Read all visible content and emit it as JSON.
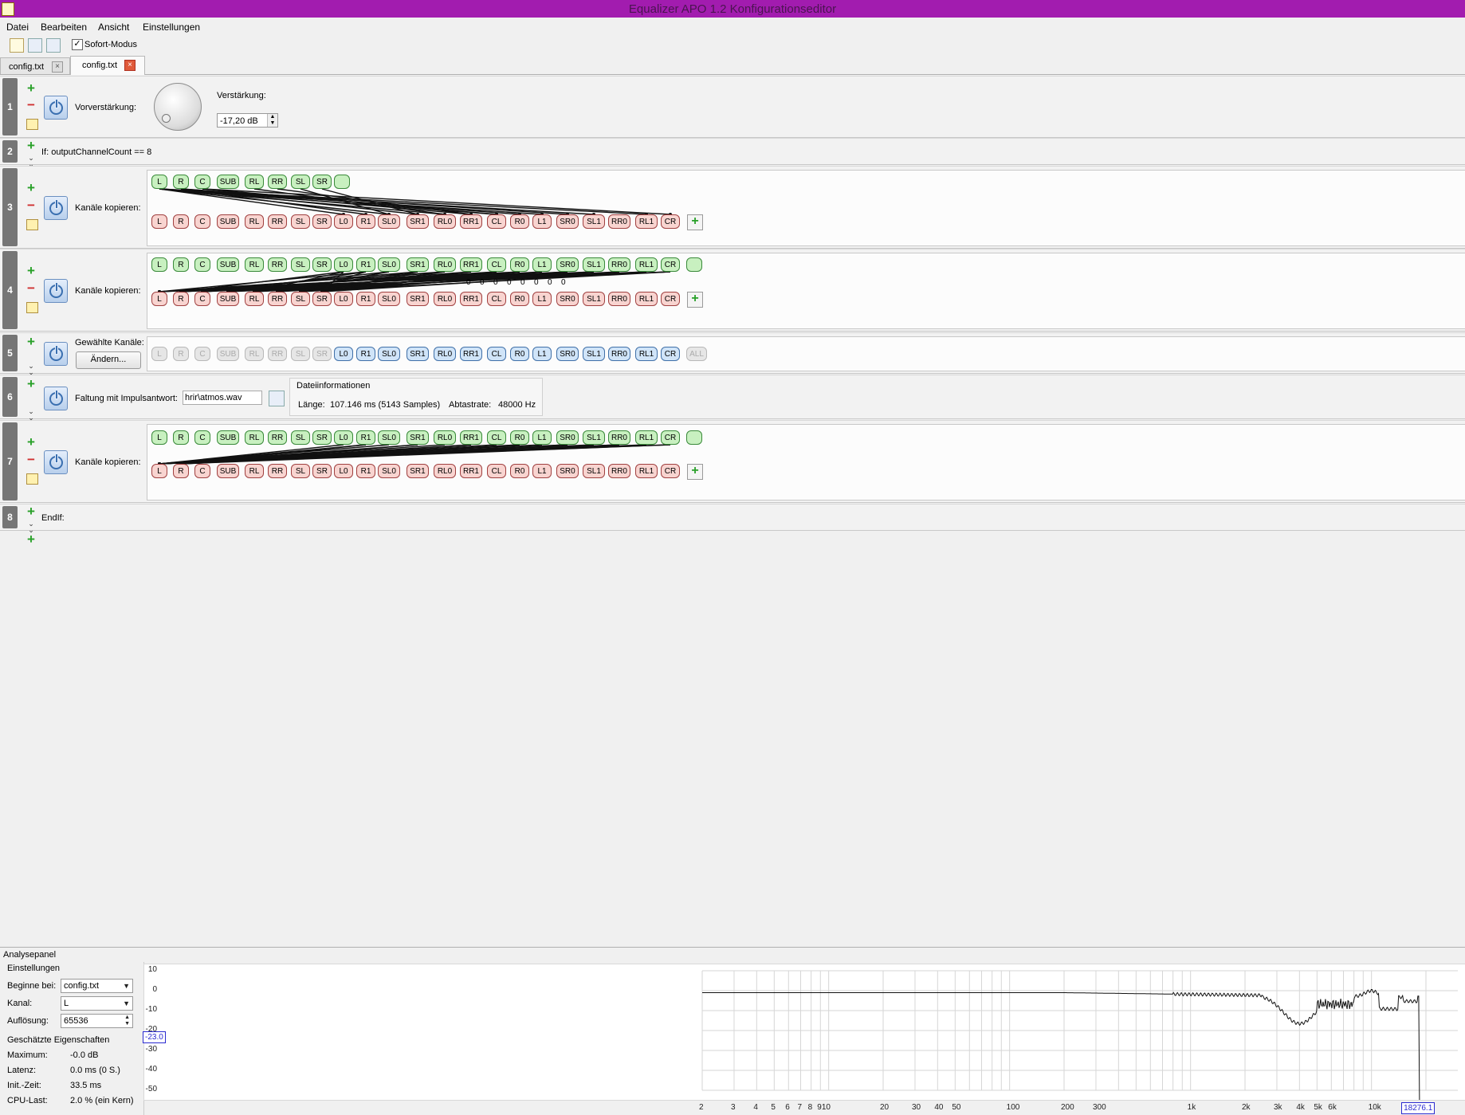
{
  "window": {
    "title": "Equalizer APO 1.2 Konfigurationseditor"
  },
  "menu": {
    "file": "Datei",
    "edit": "Bearbeiten",
    "view": "Ansicht",
    "settings": "Einstellungen"
  },
  "toolbar": {
    "instant_mode": "Sofort-Modus",
    "instant_mode_checked": true
  },
  "tabs": [
    {
      "label": "config.txt"
    },
    {
      "label": "config.txt",
      "active": true
    }
  ],
  "rows": [
    {
      "num": "1",
      "label": "Vorverstärkung:",
      "gain_label": "Verstärkung:",
      "gain_value": "-17,20 dB"
    },
    {
      "num": "2",
      "label": "If: outputChannelCount == 8"
    },
    {
      "num": "3",
      "label": "Kanäle kopieren:"
    },
    {
      "num": "4",
      "label": "Kanäle kopieren:"
    },
    {
      "num": "5",
      "label": "Gewählte Kanäle:",
      "button": "Ändern..."
    },
    {
      "num": "6",
      "label": "Faltung mit Impulsantwort:",
      "file": "hrir\\atmos.wav",
      "info_title": "Dateiinformationen",
      "length_label": "Länge:",
      "length_value": "107.146 ms (5143 Samples)",
      "rate_label": "Abtastrate:",
      "rate_value": "48000 Hz"
    },
    {
      "num": "7",
      "label": "Kanäle kopieren:"
    },
    {
      "num": "8",
      "label": "EndIf:"
    }
  ],
  "channels": {
    "row3_src": [
      "L",
      "R",
      "C",
      "SUB",
      "RL",
      "RR",
      "SL",
      "SR",
      ""
    ],
    "full": [
      "L",
      "R",
      "C",
      "SUB",
      "RL",
      "RR",
      "SL",
      "SR",
      "L0",
      "R1",
      "SL0",
      "SR1",
      "RL0",
      "RR1",
      "CL",
      "R0",
      "L1",
      "SR0",
      "SL1",
      "RR0",
      "RL1",
      "CR"
    ],
    "row5_all": "ALL",
    "row4_factors": [
      "0",
      "0",
      "0",
      "0",
      "0",
      "0",
      "0",
      "0"
    ]
  },
  "analysis": {
    "title": "Analysepanel",
    "settings_title": "Einstellungen",
    "start_label": "Beginne bei:",
    "start_value": "config.txt",
    "channel_label": "Kanal:",
    "channel_value": "L",
    "resolution_label": "Auflösung:",
    "resolution_value": "65536",
    "estimated_title": "Geschätzte Eigenschaften",
    "props": [
      {
        "label": "Maximum:",
        "value": "-0.0 dB"
      },
      {
        "label": "Latenz:",
        "value": "0.0 ms (0 S.)"
      },
      {
        "label": "Init.-Zeit:",
        "value": "33.5 ms"
      },
      {
        "label": "CPU-Last:",
        "value": "2.0 % (ein Kern)"
      }
    ],
    "y_ticks": [
      "10",
      "0",
      "-10",
      "-20",
      "-30",
      "-40",
      "-50"
    ],
    "y_marker": "-23.0",
    "x_ticks": [
      "2",
      "3",
      "4",
      "5",
      "6",
      "7",
      "8",
      "910",
      "20",
      "30",
      "40",
      "50",
      "100",
      "200",
      "300",
      "1k",
      "2k",
      "3k",
      "4k",
      "5k",
      "6k",
      "10k"
    ],
    "x_marker": "18276.1"
  }
}
